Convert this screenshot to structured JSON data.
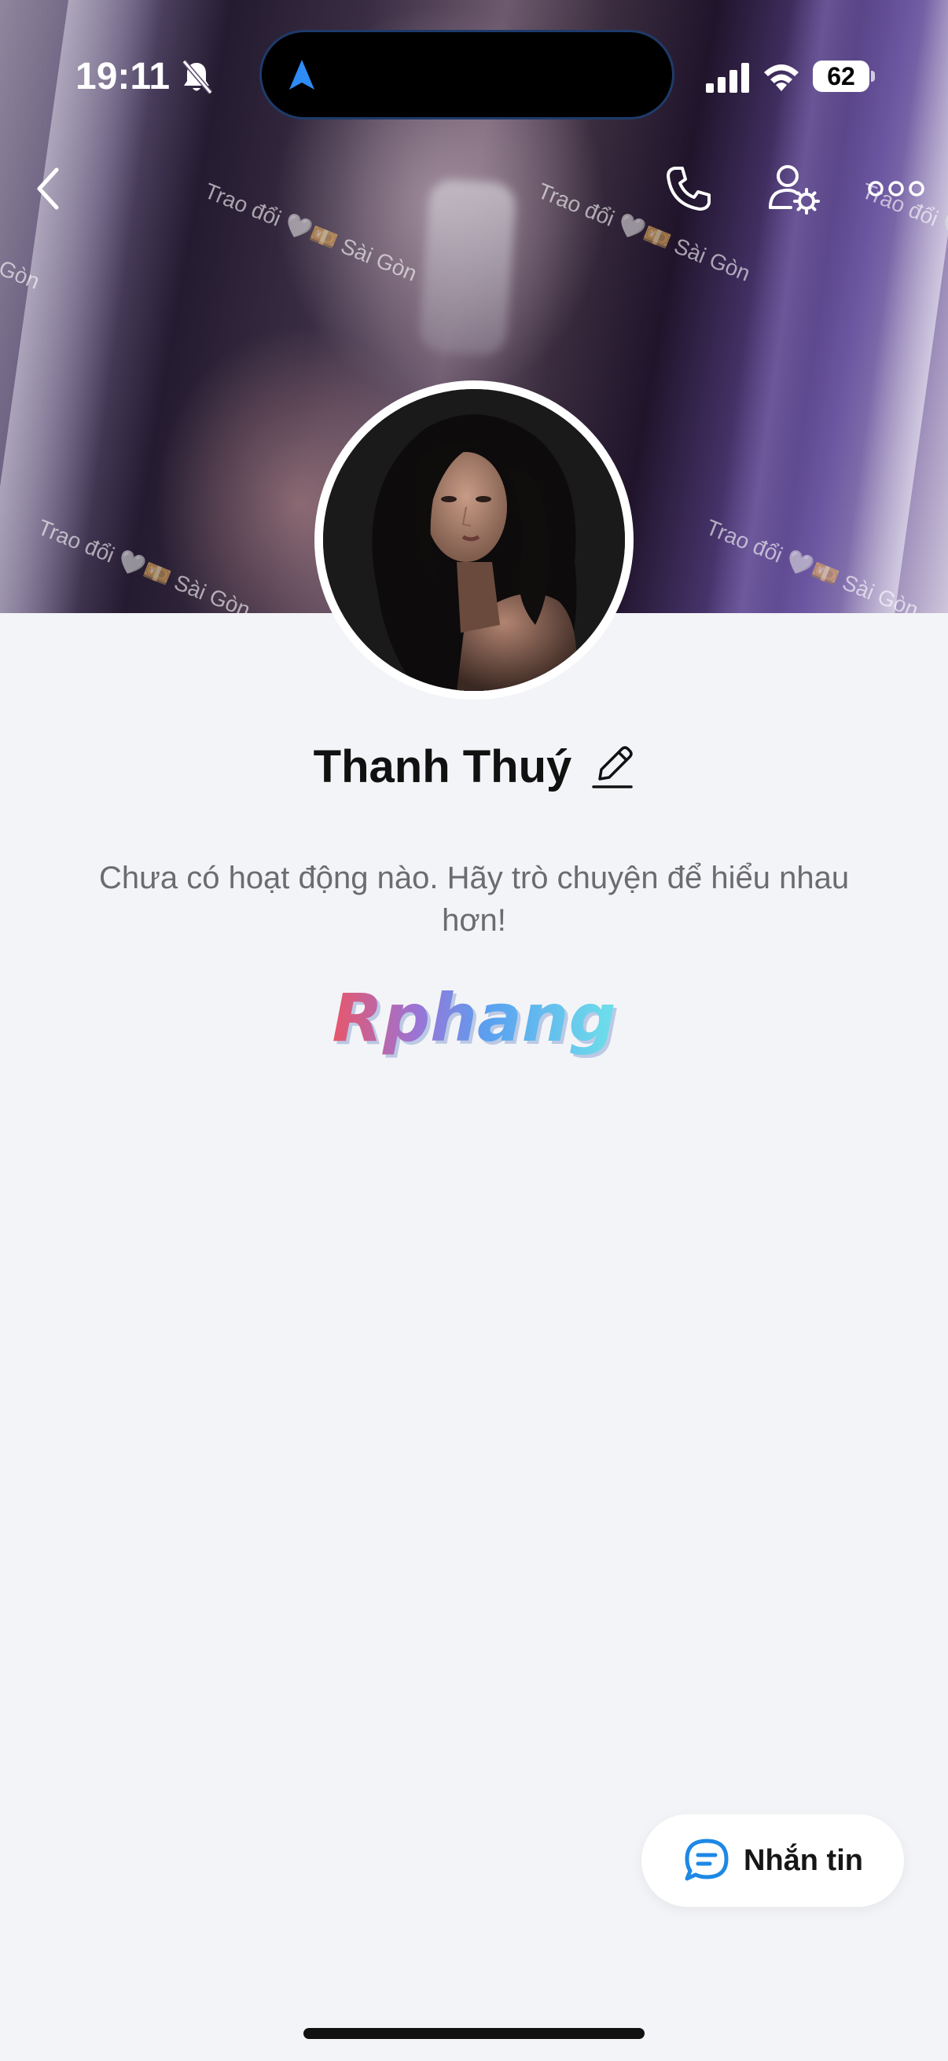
{
  "status_bar": {
    "time": "19:11",
    "battery": "62"
  },
  "cover": {
    "watermark_text": "Trao đổi 🤍💴 Sài Gòn"
  },
  "profile": {
    "name": "Thanh Thuý",
    "activity_text": "Chưa có hoạt động nào. Hãy trò chuyện để hiểu nhau hơn!"
  },
  "logo_text": "Rphang",
  "message_button": {
    "label": "Nhắn tin"
  },
  "colors": {
    "accent_blue": "#1e88e5",
    "background": "#f3f4f7"
  },
  "icons": [
    "bell-off-icon",
    "navigation-arrow-icon",
    "signal-icon",
    "wifi-icon",
    "back-chevron-icon",
    "phone-icon",
    "user-settings-icon",
    "more-dots-icon",
    "edit-pencil-icon",
    "chat-bubble-icon"
  ]
}
